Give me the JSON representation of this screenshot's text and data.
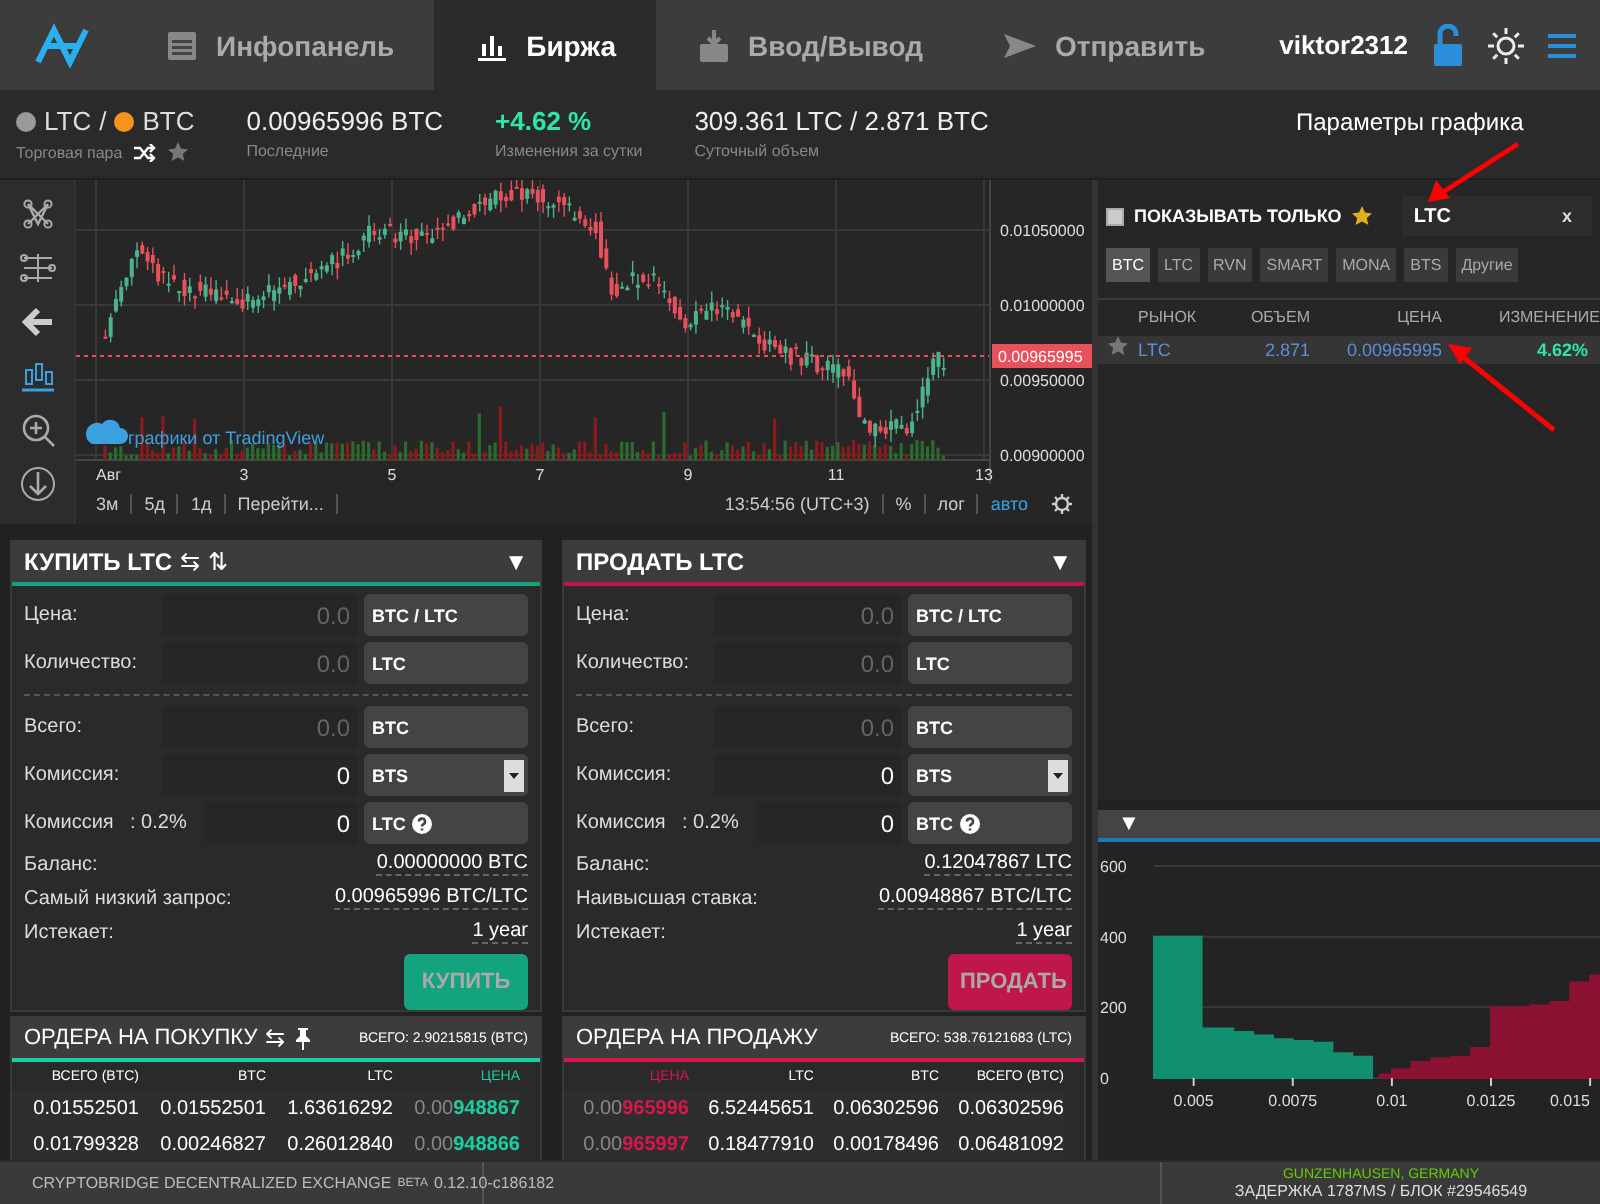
{
  "nav": {
    "tabs": [
      {
        "label": "Инфопанель",
        "selected": false
      },
      {
        "label": "Биржа",
        "selected": true
      },
      {
        "label": "Ввод/Вывод",
        "selected": false
      },
      {
        "label": "Отправить",
        "selected": false
      }
    ],
    "username": "viktor2312"
  },
  "ticker": {
    "pair": {
      "base": "LTC",
      "separator": "/",
      "quote": "BTC",
      "caption": "Торговая пара",
      "favorite": false
    },
    "stats": [
      {
        "kind": "plain",
        "value": "0.00965996 BTC",
        "caption": "Последние"
      },
      {
        "kind": "change",
        "value": "+4.62 %",
        "caption": "Изменения за сутки"
      },
      {
        "kind": "plain",
        "value": "309.361 LTC / 2.871 BTC",
        "caption": "Суточный объем"
      }
    ]
  },
  "annotation": {
    "text": "Параметры графика"
  },
  "chart": {
    "y_labels": [
      "0.01050000",
      "0.01000000",
      "0.00950000",
      "0.00900000"
    ],
    "price_tag": "0.00965995",
    "x_labels": [
      "Авг",
      "3",
      "5",
      "7",
      "9",
      "11",
      "13"
    ],
    "credit": "графики от TradingView",
    "ranges": [
      {
        "label": "3м"
      },
      {
        "label": "5д"
      },
      {
        "label": "1д"
      },
      {
        "label": "Перейти..."
      }
    ],
    "time": "13:54:56 (UTC+3)",
    "scale_options": [
      {
        "label": "%",
        "selected": false
      },
      {
        "label": "лог",
        "selected": false
      },
      {
        "label": "авто",
        "selected": true
      }
    ]
  },
  "forms": [
    {
      "color": "#14a37f",
      "title": "КУПИТЬ LTC",
      "icons": [
        "⇆",
        "⇅"
      ],
      "toggle": "▼",
      "fields": [
        {
          "kind": "input",
          "label": "Цена:",
          "placeholder": "0.0",
          "unit": "BTC / LTC"
        },
        {
          "kind": "input",
          "label": "Количество:",
          "placeholder": "0.0",
          "unit": "LTC"
        },
        {
          "kind": "divider"
        },
        {
          "kind": "input",
          "label": "Всего:",
          "placeholder": "0.0",
          "unit": "BTC"
        },
        {
          "kind": "select",
          "label": "Комиссия:",
          "value": "0",
          "unit": "BTS"
        },
        {
          "kind": "fee",
          "label": "Комиссия",
          "rate": ": 0.2%",
          "value": "0",
          "unit": "LTC"
        }
      ],
      "info": [
        {
          "label": "Баланс:",
          "value": "0.00000000 BTC"
        },
        {
          "label": "Самый низкий запрос:",
          "value": "0.00965996 BTC/LTC"
        },
        {
          "label": "Истекает:",
          "value": "1 year"
        }
      ],
      "button": "КУПИТЬ"
    },
    {
      "color": "#c0174a",
      "title": "ПРОДАТЬ LTC",
      "toggle": "▼",
      "fields": [
        {
          "kind": "input",
          "label": "Цена:",
          "placeholder": "0.0",
          "unit": "BTC / LTC"
        },
        {
          "kind": "input",
          "label": "Количество:",
          "placeholder": "0.0",
          "unit": "LTC"
        },
        {
          "kind": "divider"
        },
        {
          "kind": "input",
          "label": "Всего:",
          "placeholder": "0.0",
          "unit": "BTC"
        },
        {
          "kind": "select",
          "label": "Комиссия:",
          "value": "0",
          "unit": "BTS"
        },
        {
          "kind": "fee",
          "label": "Комиссия",
          "rate": ": 0.2%",
          "value": "0",
          "unit": "BTC"
        }
      ],
      "info": [
        {
          "label": "Баланс:",
          "value": "0.12047867 LTC"
        },
        {
          "label": "Наивысшая ставка:",
          "value": "0.00948867 BTC/LTC"
        },
        {
          "label": "Истекает:",
          "value": "1 year"
        }
      ],
      "button": "ПРОДАТЬ"
    }
  ],
  "order_books": [
    {
      "color": "#18d0a0",
      "title": "ОРДЕРА НА ПОКУПКУ",
      "icons": [
        "⇆"
      ],
      "pin_icon": true,
      "total": "ВСЕГО: 2.90215815 (BTC)",
      "columns": [
        {
          "label": "ВСЕГО (BTC)",
          "kind": "amount"
        },
        {
          "label": "BTC",
          "kind": "amount"
        },
        {
          "label": "LTC",
          "kind": "amount"
        },
        {
          "label": "ЦЕНА",
          "kind": "price"
        }
      ],
      "rows": [
        [
          "0.01552501",
          "0.01552501",
          "1.63616292",
          "0.00948867"
        ],
        [
          "0.01799328",
          "0.00246827",
          "0.26012840",
          "0.00948866"
        ]
      ]
    },
    {
      "color": "#d8164c",
      "title": "ОРДЕРА НА ПРОДАЖУ",
      "pin_icon": false,
      "total": "ВСЕГО: 538.76121683 (LTC)",
      "columns": [
        {
          "label": "ЦЕНА",
          "kind": "price"
        },
        {
          "label": "LTC",
          "kind": "amount"
        },
        {
          "label": "BTC",
          "kind": "amount"
        },
        {
          "label": "ВСЕГО (BTC)",
          "kind": "amount"
        }
      ],
      "rows": [
        [
          "0.00965996",
          "6.52445651",
          "0.06302596",
          "0.06302596"
        ],
        [
          "0.00965997",
          "0.18477910",
          "0.00178496",
          "0.06481092"
        ]
      ]
    }
  ],
  "markets": {
    "favorites_only": {
      "label": "ПОКАЗЫВАТЬ ТОЛЬКО",
      "checked": false
    },
    "search": {
      "value": "LTC",
      "clear": "x"
    },
    "filters": [
      {
        "label": "BTC",
        "selected": true
      },
      {
        "label": "LTC",
        "selected": false
      },
      {
        "label": "RVN",
        "selected": false
      },
      {
        "label": "SMART",
        "selected": false
      },
      {
        "label": "MONA",
        "selected": false
      },
      {
        "label": "BTS",
        "selected": false
      },
      {
        "label": "Другие",
        "selected": false
      }
    ],
    "columns": [
      "РЫНОК",
      "ОБЪЕМ",
      "ЦЕНА",
      "ИЗМЕНЕНИЕ"
    ],
    "rows": [
      {
        "market": "LTC",
        "volume": "2.871",
        "price": "0.00965995",
        "change": "4.62%",
        "favorite": false,
        "selected": true
      }
    ]
  },
  "depth": {
    "toggle": "▼",
    "chart_data": {
      "type": "area",
      "x": [
        0.004,
        0.005,
        0.0052,
        0.006,
        0.0065,
        0.007,
        0.0075,
        0.008,
        0.0085,
        0.009,
        0.0095,
        0.0097,
        0.01,
        0.0105,
        0.011,
        0.0115,
        0.012,
        0.0125,
        0.013,
        0.0135,
        0.014,
        0.0145,
        0.015,
        0.0153
      ],
      "series": [
        {
          "color": "#11906f",
          "values": [
            400,
            400,
            140,
            130,
            120,
            110,
            105,
            100,
            70,
            60,
            25,
            null,
            null,
            null,
            null,
            null,
            null,
            null,
            null,
            null,
            null,
            null,
            null,
            null
          ]
        },
        {
          "color": "#8c1233",
          "values": [
            null,
            null,
            null,
            null,
            null,
            null,
            null,
            null,
            null,
            null,
            null,
            10,
            25,
            45,
            55,
            60,
            85,
            200,
            200,
            205,
            215,
            270,
            290,
            300
          ]
        }
      ],
      "xlim": [
        0.004,
        0.0153
      ],
      "ylim": [
        0,
        600
      ],
      "xticks": [
        0.005,
        0.0075,
        0.01,
        0.0125,
        0.015
      ],
      "yticks": [
        0,
        200,
        400,
        600
      ]
    }
  },
  "footer": {
    "app_name": "CRYPTOBRIDGE DECENTRALIZED EXCHANGE",
    "badge": "BETA",
    "version": "0.12.10-c186182",
    "location": "GUNZENHAUSEN, GERMANY",
    "latency": "ЗАДЕРЖКА 1787MS / БЛОК #29546549"
  }
}
